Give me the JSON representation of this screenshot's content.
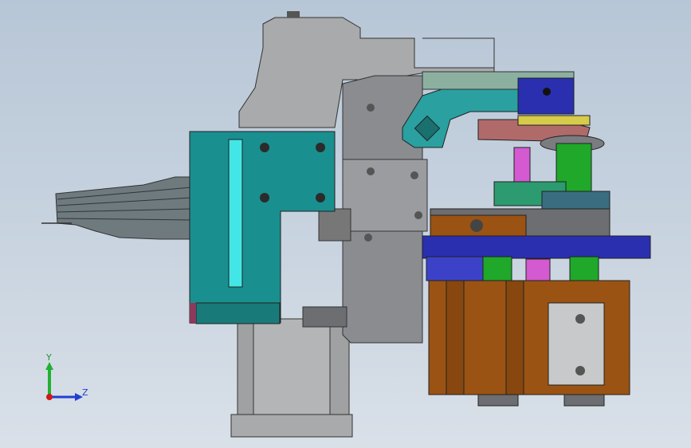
{
  "viewport": {
    "background_top": "#b7c6d6",
    "background_bottom": "#d9e0e8"
  },
  "triad": {
    "y_label": "Y",
    "z_label": "Z",
    "y_color": "#22b030",
    "z_color": "#1f3fd0",
    "origin_color": "#d01818"
  },
  "part_colors": {
    "housing_gray": "#a9aaab",
    "cylinder_gray": "#8e9094",
    "bracket_teal": "#1a8f8f",
    "slot_cyan": "#43e6e6",
    "die_brown": "#9b5313",
    "plate_blue": "#2a2fb0",
    "rod_green": "#1fa82a",
    "arm_teal": "#2aa0a0",
    "pad_rose": "#b06a6a",
    "block_magenta": "#d35ad0",
    "sheet_gray": "#6f7a7f"
  }
}
